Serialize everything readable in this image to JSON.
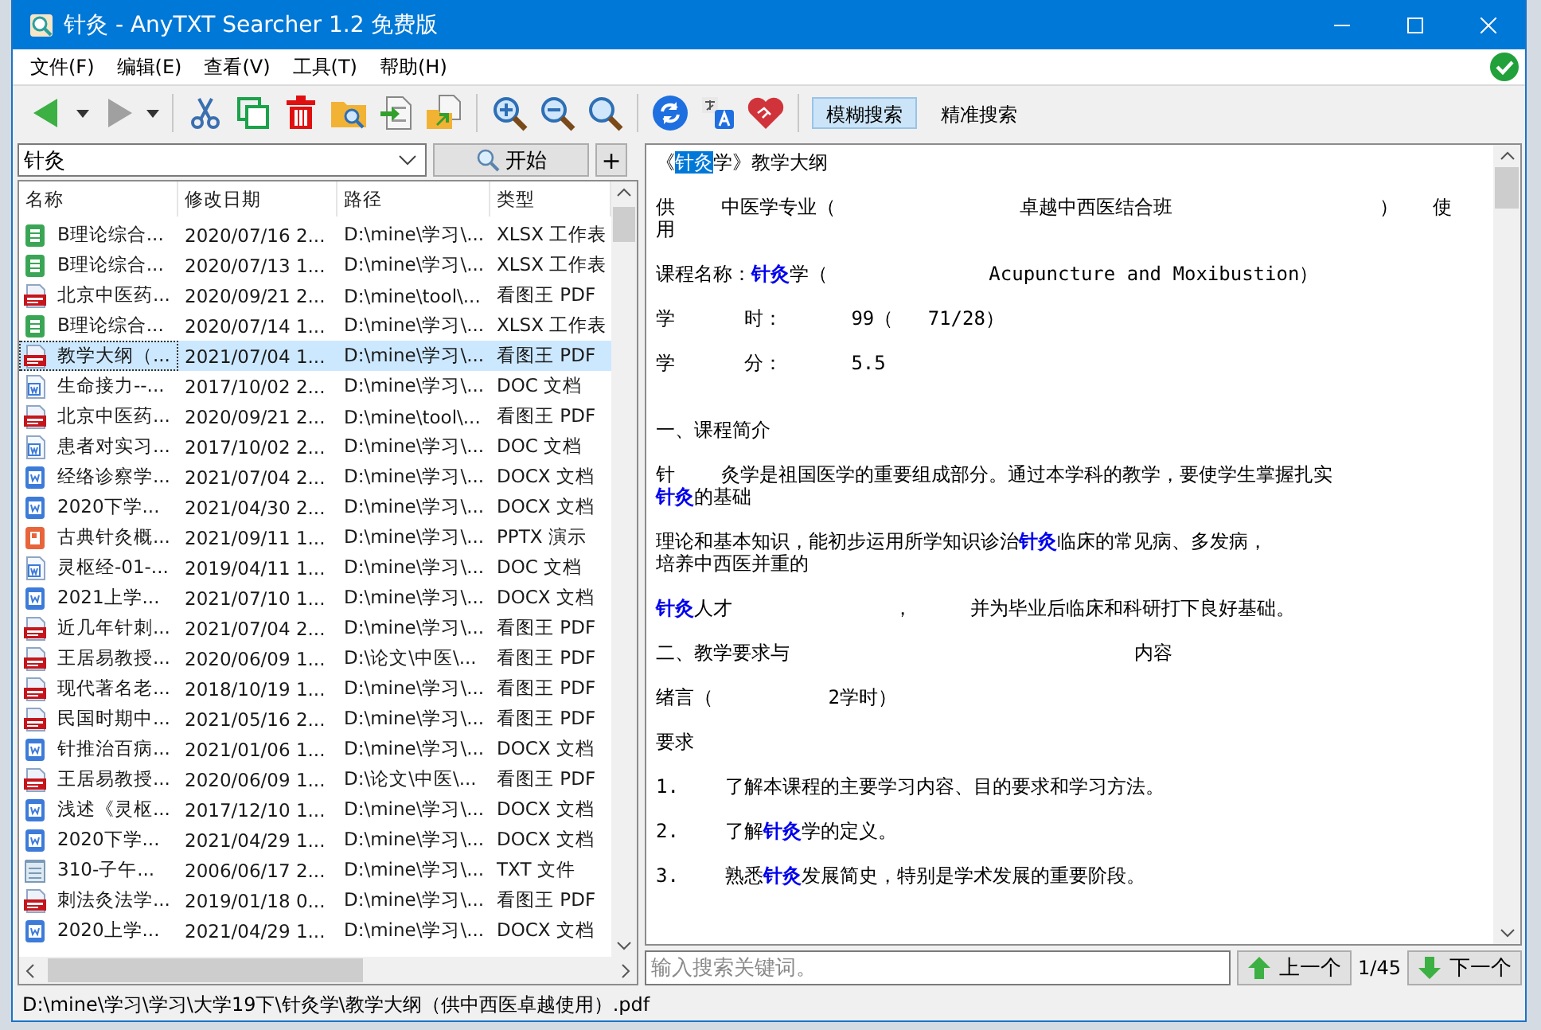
{
  "window": {
    "title": "针灸 - AnyTXT Searcher 1.2 免费版"
  },
  "menu": [
    "文件(F)",
    "编辑(E)",
    "查看(V)",
    "工具(T)",
    "帮助(H)"
  ],
  "search_modes": [
    {
      "label": "模糊搜索",
      "selected": true
    },
    {
      "label": "精准搜索",
      "selected": false
    }
  ],
  "search": {
    "value": "针灸",
    "button": "开始",
    "add_button": "+"
  },
  "table": {
    "columns": [
      "名称",
      "修改日期",
      "路径",
      "类型"
    ],
    "rows": [
      {
        "kind": "xlsx",
        "name": "B理论综合...",
        "modified": "2020/07/16 2...",
        "path": "D:\\mine\\学习\\...",
        "type": "XLSX 工作表",
        "selected": false
      },
      {
        "kind": "xlsx",
        "name": "B理论综合...",
        "modified": "2020/07/13 1...",
        "path": "D:\\mine\\学习\\...",
        "type": "XLSX 工作表",
        "selected": false
      },
      {
        "kind": "pdf",
        "name": "北京中医药...",
        "modified": "2020/09/21 2...",
        "path": "D:\\mine\\tool\\...",
        "type": "看图王 PDF",
        "selected": false
      },
      {
        "kind": "xlsx",
        "name": "B理论综合...",
        "modified": "2020/07/14 1...",
        "path": "D:\\mine\\学习\\...",
        "type": "XLSX 工作表",
        "selected": false
      },
      {
        "kind": "pdf",
        "name": "教学大纲（...",
        "modified": "2021/07/04 1...",
        "path": "D:\\mine\\学习\\...",
        "type": "看图王 PDF",
        "selected": true
      },
      {
        "kind": "doc",
        "name": "生命接力--...",
        "modified": "2017/10/02 2...",
        "path": "D:\\mine\\学习\\...",
        "type": "DOC 文档",
        "selected": false
      },
      {
        "kind": "pdf",
        "name": "北京中医药...",
        "modified": "2020/09/21 2...",
        "path": "D:\\mine\\tool\\...",
        "type": "看图王 PDF",
        "selected": false
      },
      {
        "kind": "doc",
        "name": "患者对实习...",
        "modified": "2017/10/02 2...",
        "path": "D:\\mine\\学习\\...",
        "type": "DOC 文档",
        "selected": false
      },
      {
        "kind": "docx",
        "name": "经络诊察学...",
        "modified": "2021/07/04 2...",
        "path": "D:\\mine\\学习\\...",
        "type": "DOCX 文档",
        "selected": false
      },
      {
        "kind": "docx",
        "name": "2020下学...",
        "modified": "2021/04/30 2...",
        "path": "D:\\mine\\学习\\...",
        "type": "DOCX 文档",
        "selected": false
      },
      {
        "kind": "pptx",
        "name": "古典针灸概...",
        "modified": "2021/09/11 1...",
        "path": "D:\\mine\\学习\\...",
        "type": "PPTX 演示",
        "selected": false
      },
      {
        "kind": "doc",
        "name": "灵枢经-01-...",
        "modified": "2019/04/11 1...",
        "path": "D:\\mine\\学习\\...",
        "type": "DOC 文档",
        "selected": false
      },
      {
        "kind": "docx",
        "name": "2021上学...",
        "modified": "2021/07/10 1...",
        "path": "D:\\mine\\学习\\...",
        "type": "DOCX 文档",
        "selected": false
      },
      {
        "kind": "pdf",
        "name": "近几年针刺...",
        "modified": "2021/07/04 2...",
        "path": "D:\\mine\\学习\\...",
        "type": "看图王 PDF",
        "selected": false
      },
      {
        "kind": "pdf",
        "name": "王居易教授...",
        "modified": "2020/06/09 1...",
        "path": "D:\\论文\\中医\\...",
        "type": "看图王 PDF",
        "selected": false
      },
      {
        "kind": "pdf",
        "name": "现代著名老...",
        "modified": "2018/10/19 1...",
        "path": "D:\\mine\\学习\\...",
        "type": "看图王 PDF",
        "selected": false
      },
      {
        "kind": "pdf",
        "name": "民国时期中...",
        "modified": "2021/05/16 2...",
        "path": "D:\\mine\\学习\\...",
        "type": "看图王 PDF",
        "selected": false
      },
      {
        "kind": "docx",
        "name": "针推治百病...",
        "modified": "2021/01/06 1...",
        "path": "D:\\mine\\学习\\...",
        "type": "DOCX 文档",
        "selected": false
      },
      {
        "kind": "pdf",
        "name": "王居易教授...",
        "modified": "2020/06/09 1...",
        "path": "D:\\论文\\中医\\...",
        "type": "看图王 PDF",
        "selected": false
      },
      {
        "kind": "docx",
        "name": "浅述《灵枢...",
        "modified": "2017/12/10 1...",
        "path": "D:\\mine\\学习\\...",
        "type": "DOCX 文档",
        "selected": false
      },
      {
        "kind": "docx",
        "name": "2020下学...",
        "modified": "2021/04/29 1...",
        "path": "D:\\mine\\学习\\...",
        "type": "DOCX 文档",
        "selected": false
      },
      {
        "kind": "txt",
        "name": "310-子午...",
        "modified": "2006/06/17 2...",
        "path": "D:\\mine\\学习\\...",
        "type": "TXT 文件",
        "selected": false
      },
      {
        "kind": "pdf",
        "name": "刺法灸法学...",
        "modified": "2019/01/18 0...",
        "path": "D:\\mine\\学习\\...",
        "type": "看图王 PDF",
        "selected": false
      },
      {
        "kind": "docx",
        "name": "2020上学...",
        "modified": "2021/04/29 1...",
        "path": "D:\\mine\\学习\\...",
        "type": "DOCX 文档",
        "selected": false
      }
    ]
  },
  "document": {
    "paragraphs": [
      {
        "kind": "title",
        "lines": [
          "《**针灸**学》教学大纲"
        ]
      },
      {
        "kind": "line",
        "lines": [
          "供    中医学专业（                卓越中西医结合班                  ）   使",
          "用"
        ]
      },
      {
        "kind": "line",
        "lines": [
          "课程名称：**针灸**学（              Acupuncture and Moxibustion）"
        ]
      },
      {
        "kind": "line",
        "lines": [
          "学      时：      99（   71/28）"
        ]
      },
      {
        "kind": "line",
        "lines": [
          "学      分：      5.5"
        ]
      },
      {
        "kind": "section",
        "lines": [
          "一、课程简介"
        ]
      },
      {
        "kind": "line",
        "lines": [
          "针    灸学是祖国医学的重要组成部分。通过本学科的教学，要使学生掌握扎实",
          "**针灸**的基础"
        ]
      },
      {
        "kind": "line",
        "lines": [
          "理论和基本知识，能初步运用所学知识诊治**针灸**临床的常见病、多发病，",
          "培养中西医并重的"
        ]
      },
      {
        "kind": "line",
        "lines": [
          "**针灸**人才              ，     并为毕业后临床和科研打下良好基础。"
        ]
      },
      {
        "kind": "section",
        "lines": [
          "二、教学要求与                              内容"
        ]
      },
      {
        "kind": "line",
        "lines": [
          "绪言（          2学时）"
        ]
      },
      {
        "kind": "line",
        "lines": [
          "要求"
        ]
      },
      {
        "kind": "line",
        "lines": [
          "1.    了解本课程的主要学习内容、目的要求和学习方法。"
        ]
      },
      {
        "kind": "line",
        "lines": [
          "2.    了解**针灸**学的定义。"
        ]
      },
      {
        "kind": "line",
        "lines": [
          "3.    熟悉**针灸**发展简史，特别是学术发展的重要阶段。"
        ]
      }
    ]
  },
  "find_bar": {
    "placeholder": "输入搜索关键词。",
    "prev_button": "上一个",
    "counter": "1/45",
    "next_button": "下一个"
  },
  "status_bar": "D:\\mine\\学习\\学习\\大学19下\\针灸学\\教学大纲（供中西医卓越使用）.pdf"
}
